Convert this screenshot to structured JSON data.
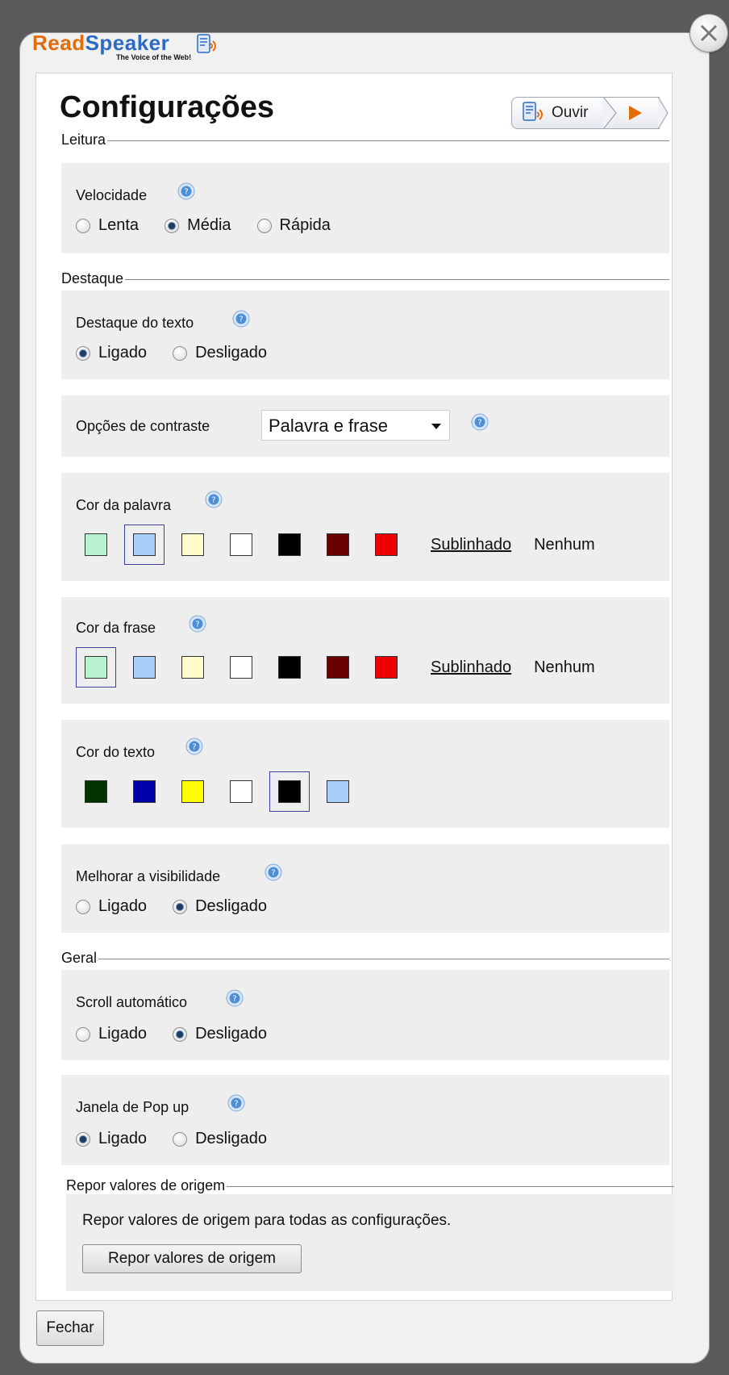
{
  "dialog": {
    "logo_read": "Read",
    "logo_speaker": "Speaker",
    "logo_tagline": "The Voice of the Web!",
    "title": "Configurações",
    "listen_label": "Ouvir",
    "close_label": "Fechar"
  },
  "colors": {
    "brand_orange": "#e36c0a",
    "brand_blue": "#2d6bc4",
    "radio_selected": "#1f3c63",
    "help_icon": "#4d8fd6"
  },
  "sections": {
    "leitura": {
      "legend": "Leitura",
      "velocidade": {
        "label": "Velocidade",
        "options": [
          "Lenta",
          "Média",
          "Rápida"
        ],
        "selected": "Média"
      }
    },
    "destaque": {
      "legend": "Destaque",
      "destaque_texto": {
        "label": "Destaque do texto",
        "options": [
          "Ligado",
          "Desligado"
        ],
        "selected": "Ligado"
      },
      "contraste": {
        "label": "Opções de contraste",
        "value": "Palavra e frase"
      },
      "cor_palavra": {
        "label": "Cor da palavra",
        "swatches": [
          "#b8f2d0",
          "#a9cef7",
          "#fffccc",
          "#ffffff",
          "#000000",
          "#6a0000",
          "#ee0000"
        ],
        "selected_index": 1,
        "underline": "Sublinhado",
        "none": "Nenhum"
      },
      "cor_frase": {
        "label": "Cor da frase",
        "swatches": [
          "#b8f2d0",
          "#a9cef7",
          "#fffccc",
          "#ffffff",
          "#000000",
          "#6a0000",
          "#ee0000"
        ],
        "selected_index": 0,
        "underline": "Sublinhado",
        "none": "Nenhum"
      },
      "cor_texto": {
        "label": "Cor do texto",
        "swatches": [
          "#003300",
          "#0000aa",
          "#ffff00",
          "#ffffff",
          "#000000",
          "#a9cef7"
        ],
        "selected_index": 4
      },
      "visibilidade": {
        "label": "Melhorar a visibilidade",
        "options": [
          "Ligado",
          "Desligado"
        ],
        "selected": "Desligado"
      }
    },
    "geral": {
      "legend": "Geral",
      "scroll": {
        "label": "Scroll automático",
        "options": [
          "Ligado",
          "Desligado"
        ],
        "selected": "Desligado"
      },
      "popup": {
        "label": "Janela de Pop up",
        "options": [
          "Ligado",
          "Desligado"
        ],
        "selected": "Ligado"
      }
    },
    "reset": {
      "legend": "Repor valores de origem",
      "description": "Repor valores de origem para todas as configurações.",
      "button": "Repor valores de origem"
    }
  }
}
